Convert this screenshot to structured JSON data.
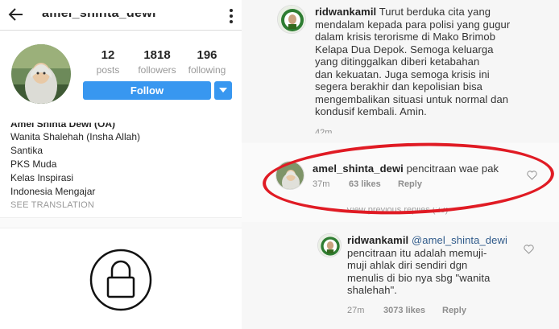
{
  "profile": {
    "header_username": "amel_shinta_dewi",
    "stats": [
      {
        "count": "12",
        "label": "posts"
      },
      {
        "count": "1818",
        "label": "followers"
      },
      {
        "count": "196",
        "label": "following"
      }
    ],
    "follow_label": "Follow",
    "bio_name": "Amel Shinta Dewi (OA)",
    "bio_lines": [
      "Wanita Shalehah (Insha Allah)",
      "Santika",
      "PKS Muda",
      "Kelas Inspirasi",
      "Indonesia Mengajar"
    ],
    "see_translation": "SEE TRANSLATION"
  },
  "comments": {
    "first": {
      "user": "ridwankamil",
      "text": "Turut berduka cita yang\nmendalam kepada para polisi yang gugur\ndalam krisis terorisme di Mako Brimob\nKelapa Dua Depok. Semoga keluarga\nyang ditinggalkan diberi ketabahan\ndan kekuatan. Juga semoga krisis ini\nsegera berakhir dan kepolisian bisa\nmengembalikan situasi  untuk normal dan\nkondusif kembali.  Amin.",
      "time": "42m"
    },
    "second": {
      "user": "amel_shinta_dewi",
      "text": "pencitraan wae pak",
      "time": "37m",
      "likes": "63 likes",
      "reply": "Reply"
    },
    "view_previous": "View previous replies (23)",
    "third": {
      "user": "ridwankamil",
      "mention": "@amel_shinta_dewi",
      "text": "pencitraan itu adalah memuji-\nmuji ahlak diri sendiri dgn\nmenulis di bio nya sbg \"wanita\nshalehah\".",
      "time": "27m",
      "likes": "3073 likes",
      "reply": "Reply"
    }
  },
  "colors": {
    "follow_blue": "#3897f0",
    "annotation_red": "#e01b24",
    "mention_blue": "#2f5a8a"
  }
}
